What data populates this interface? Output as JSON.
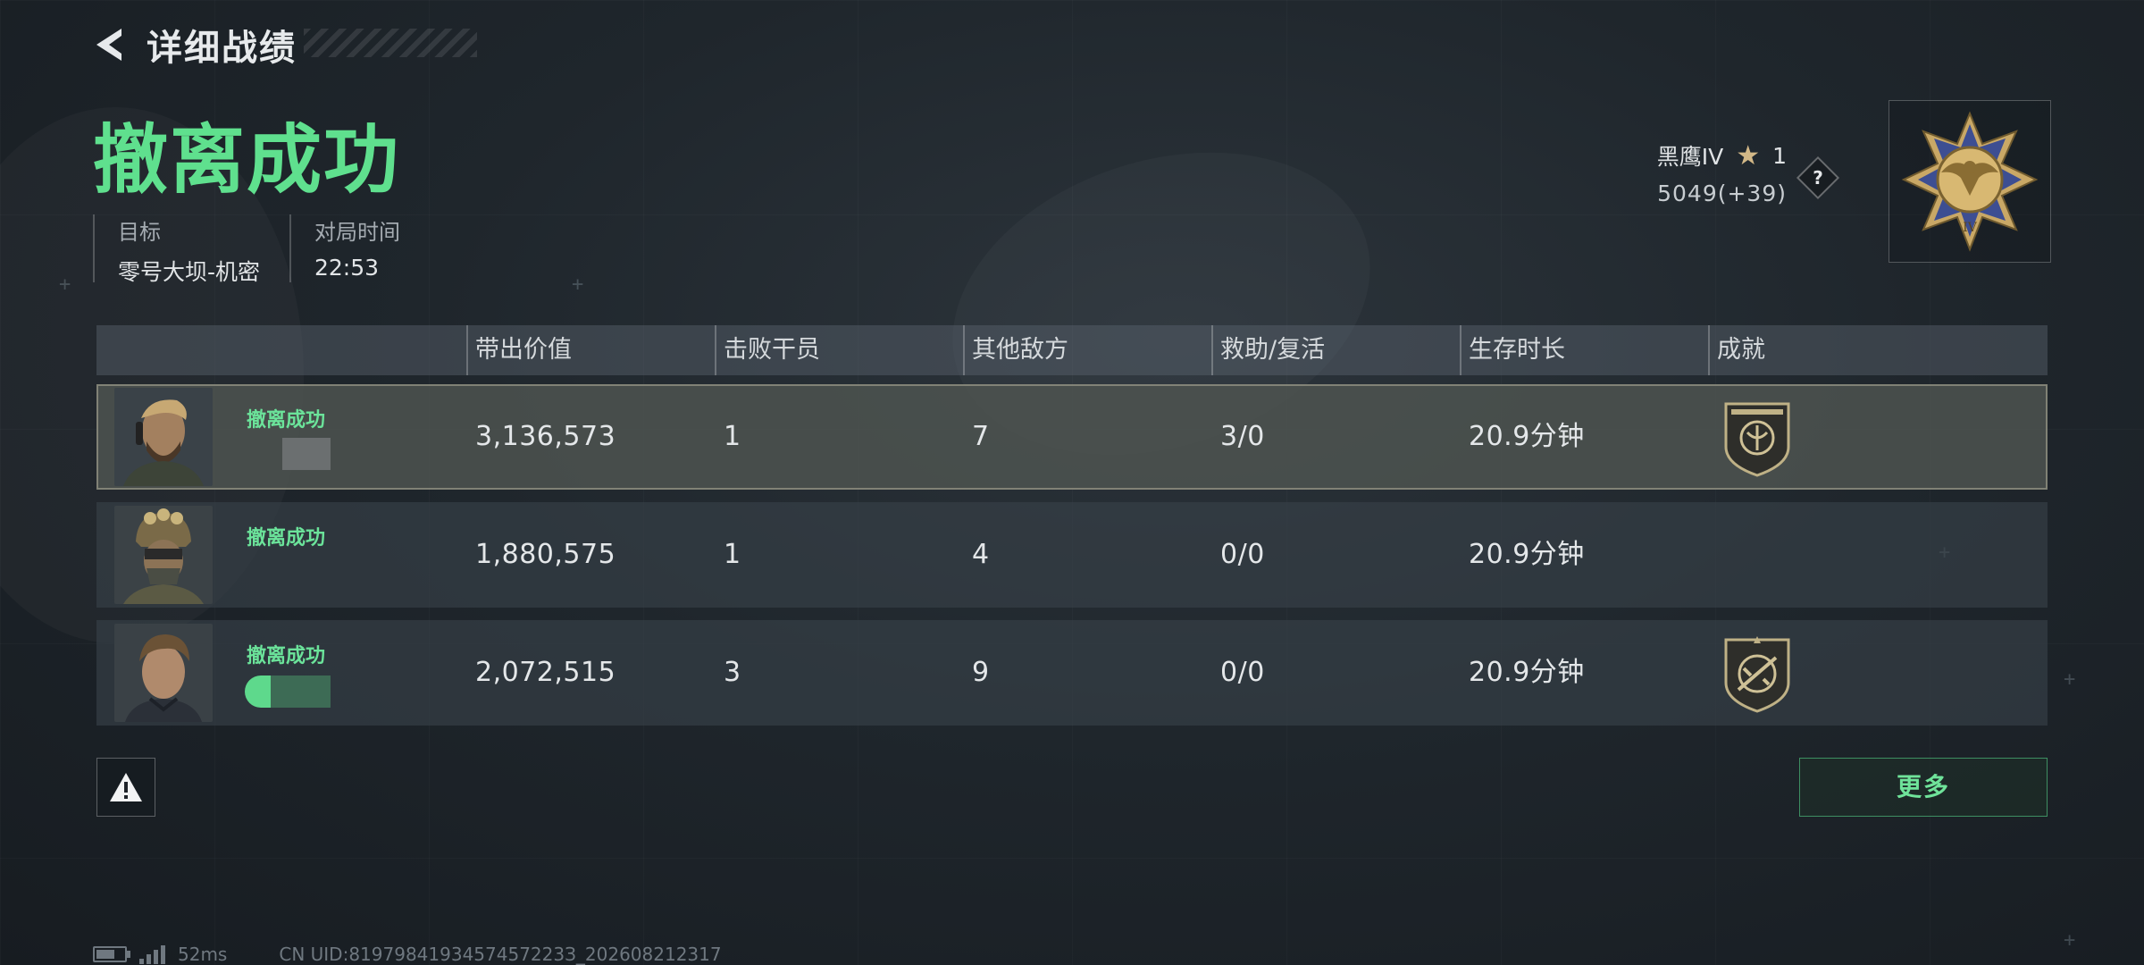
{
  "header": {
    "back_icon": "back-arrow-icon",
    "title": "详细战绩"
  },
  "result": {
    "title": "撤离成功",
    "color": "#5fe08e"
  },
  "info": {
    "target_label": "目标",
    "target_value": "零号大坝-机密",
    "time_label": "对局时间",
    "time_value": "22:53"
  },
  "rank": {
    "name": "黑鹰IV",
    "star_icon": "star-icon",
    "stars": "1",
    "score": "5049(+39)",
    "help_label": "?",
    "medal_icon": "eagle-medal-icon"
  },
  "table": {
    "headers": [
      "带出价值",
      "击败干员",
      "其他敌方",
      "救助/复活",
      "生存时长",
      "成就"
    ],
    "rows": [
      {
        "status": "撤离成功",
        "value": "3,136,573",
        "kills": "1",
        "other": "7",
        "assist": "3/0",
        "survival": "20.9分钟",
        "achievement_icon": "achievement-badge-icon",
        "selected": true
      },
      {
        "status": "撤离成功",
        "value": "1,880,575",
        "kills": "1",
        "other": "4",
        "assist": "0/0",
        "survival": "20.9分钟",
        "achievement_icon": ""
      },
      {
        "status": "撤离成功",
        "value": "2,072,515",
        "kills": "3",
        "other": "9",
        "assist": "0/0",
        "survival": "20.9分钟",
        "achievement_icon": "rifle-badge-icon"
      }
    ]
  },
  "actions": {
    "report_icon": "warning-icon",
    "more_label": "更多"
  },
  "footer": {
    "ping": "52ms",
    "uid": "CN UID:8197984193457457223З_202608212317"
  }
}
